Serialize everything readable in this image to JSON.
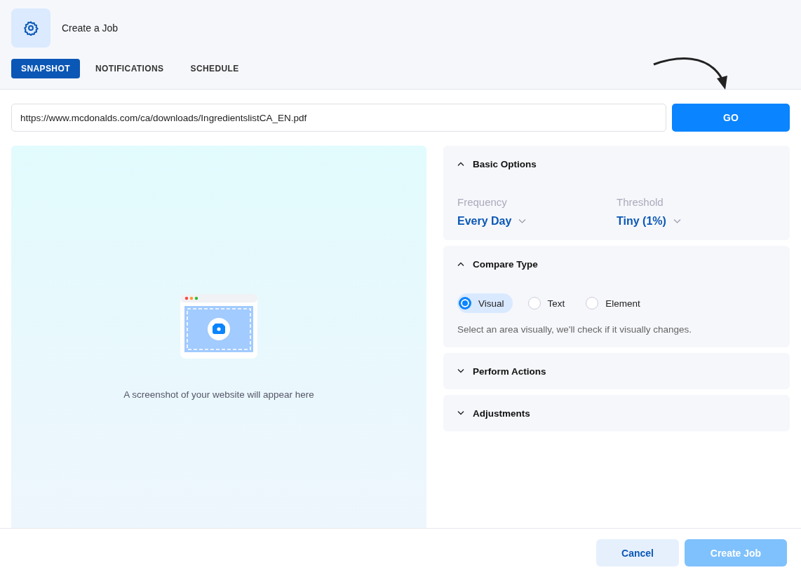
{
  "header": {
    "title": "Create a Job"
  },
  "tabs": [
    {
      "label": "SNAPSHOT",
      "selected": true
    },
    {
      "label": "NOTIFICATIONS",
      "selected": false
    },
    {
      "label": "SCHEDULE",
      "selected": false
    }
  ],
  "url_field": {
    "value": "https://www.mcdonalds.com/ca/downloads/IngredientslistCA_EN.pdf"
  },
  "go_button": "GO",
  "preview": {
    "caption": "A screenshot of your website will appear here"
  },
  "sections": [
    {
      "kind": "options",
      "title": "Basic Options",
      "expanded": true,
      "fields": [
        {
          "label": "Frequency",
          "value": "Every Day"
        },
        {
          "label": "Threshold",
          "value": "Tiny (1%)"
        }
      ]
    },
    {
      "kind": "radios",
      "title": "Compare Type",
      "expanded": true,
      "options": [
        {
          "label": "Visual",
          "selected": true
        },
        {
          "label": "Text",
          "selected": false
        },
        {
          "label": "Element",
          "selected": false
        }
      ],
      "hint": "Select an area visually, we'll check if it visually changes."
    },
    {
      "title": "Perform Actions",
      "expanded": false
    },
    {
      "title": "Adjustments",
      "expanded": false
    }
  ],
  "footer": {
    "cancel": "Cancel",
    "create": {
      "label": "Create Job",
      "disabled": true
    }
  }
}
